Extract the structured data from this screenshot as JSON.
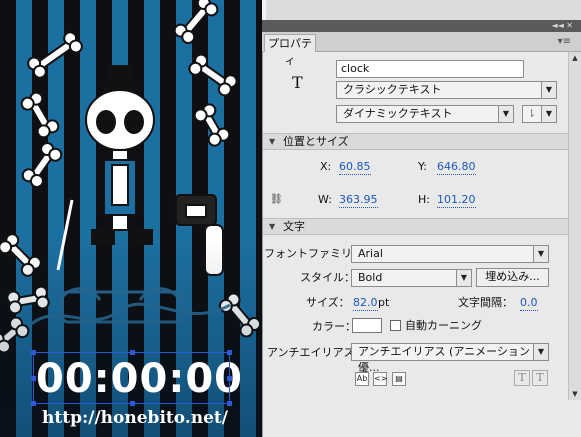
{
  "panel": {
    "tab_label": "プロパティ",
    "menu_icon": "panel-menu-icon",
    "instance_name": "clock",
    "text_engine": "クラシックテキスト",
    "text_type": "ダイナミックテキスト",
    "tool_icon_glyph": "T"
  },
  "position_size": {
    "header": "位置とサイズ",
    "x_label": "X:",
    "x_value": "60.85",
    "y_label": "Y:",
    "y_value": "646.80",
    "w_label": "W:",
    "w_value": "363.95",
    "h_label": "H:",
    "h_value": "101.20"
  },
  "character": {
    "header": "文字",
    "font_family_label": "フォントファミリー：",
    "font_family_value": "Arial",
    "style_label": "スタイル：",
    "style_value": "Bold",
    "embed_button": "埋め込み...",
    "size_label": "サイズ：",
    "size_value": "82.0",
    "size_unit": "pt",
    "spacing_label": "文字間隔：",
    "spacing_value": "0.0",
    "color_label": "カラー：",
    "color_value": "#ffffff",
    "auto_kerning_label": "自動カーニング",
    "antialias_label": "アンチエイリアス：",
    "antialias_value": "アンチエイリアス (アニメーション優...",
    "superscript_glyph": "T",
    "subscript_glyph": "T"
  },
  "stage": {
    "clock_text": "00:00:00",
    "url_text": "http://honebito.net/",
    "background_dark": "#0d0f13",
    "background_stripe": "#1c6fa1",
    "selection_color": "#2d5bd8"
  }
}
